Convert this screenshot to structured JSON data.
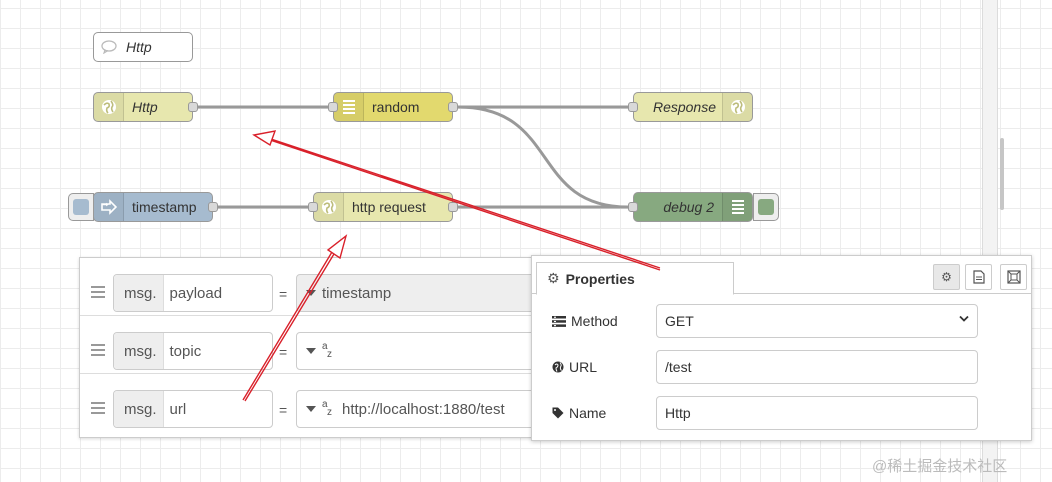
{
  "flow": {
    "nodes": {
      "comment": {
        "label": "Http",
        "icon": "comment-icon",
        "color": "#ffffff"
      },
      "http_in": {
        "label": "Http",
        "icon": "globe-icon",
        "color": "#e7e7ae"
      },
      "random": {
        "label": "random",
        "icon": "list-icon",
        "color": "#e2d96e"
      },
      "response": {
        "label": "Response",
        "icon": "globe-icon",
        "color": "#e7e7ae"
      },
      "timestamp": {
        "label": "timestamp",
        "icon": "arrow-right-icon",
        "color": "#a6bbcf"
      },
      "http_request": {
        "label": "http request",
        "icon": "globe-icon",
        "color": "#e7e7ae"
      },
      "debug": {
        "label": "debug 2",
        "icon": "list-icon",
        "color": "#87a980"
      }
    }
  },
  "change_rules": [
    {
      "prefix": "msg.",
      "property": "payload",
      "op": "=",
      "type_icon": "caret-down-icon",
      "value": "timestamp"
    },
    {
      "prefix": "msg.",
      "property": "topic",
      "op": "=",
      "type_icon": "string-az-icon",
      "value": ""
    },
    {
      "prefix": "msg.",
      "property": "url",
      "op": "=",
      "type_icon": "string-az-icon",
      "value": "http://localhost:1880/test"
    }
  ],
  "properties_panel": {
    "tab_label": "Properties",
    "fields": {
      "method": {
        "label": "Method",
        "value": "GET"
      },
      "url": {
        "label": "URL",
        "value": "/test"
      },
      "name": {
        "label": "Name",
        "value": "Http"
      }
    }
  },
  "watermark": "@稀土掘金技术社区",
  "colors": {
    "annotation_arrow": "#d9202a",
    "wire": "#999999"
  }
}
